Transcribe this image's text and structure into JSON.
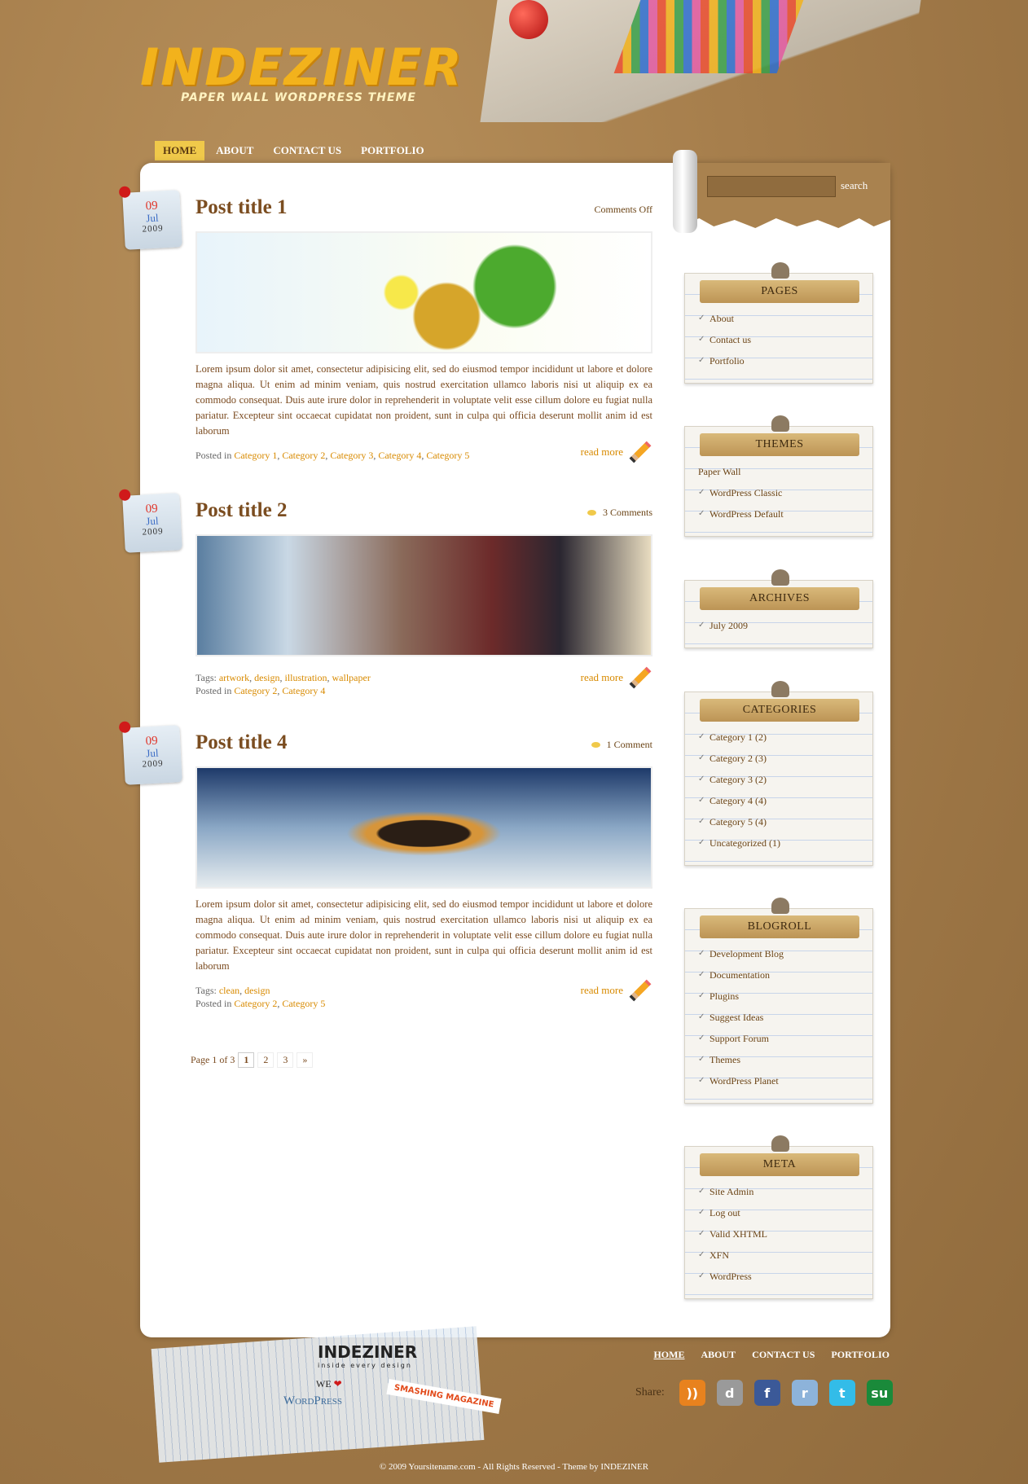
{
  "header": {
    "logo_title": "INDEZINER",
    "logo_tagline": "PAPER WALL WORDPRESS THEME"
  },
  "nav": [
    {
      "label": "HOME",
      "active": true
    },
    {
      "label": "ABOUT"
    },
    {
      "label": "CONTACT US"
    },
    {
      "label": "PORTFOLIO"
    }
  ],
  "search": {
    "value": "",
    "button": "search"
  },
  "posts": [
    {
      "day": "09",
      "month": "Jul",
      "year": "2009",
      "title": "Post title 1",
      "comments": "Comments Off",
      "comment_bubble": false,
      "image": "img1",
      "text": "Lorem ipsum dolor sit amet, consectetur adipisicing elit, sed do eiusmod tempor incididunt ut labore et dolore magna aliqua. Ut enim ad minim veniam, quis nostrud exercitation ullamco laboris nisi ut aliquip ex ea commodo consequat. Duis aute irure dolor in reprehenderit in voluptate velit esse cillum dolore eu fugiat nulla pariatur. Excepteur sint occaecat cupidatat non proident, sunt in culpa qui officia deserunt mollit anim id est laborum",
      "tags": [],
      "categories": [
        "Category 1",
        "Category 2",
        "Category 3",
        "Category 4",
        "Category 5"
      ],
      "read_more": "read more"
    },
    {
      "day": "09",
      "month": "Jul",
      "year": "2009",
      "title": "Post title 2",
      "comments": "3 Comments",
      "comment_bubble": true,
      "image": "img2",
      "text": "",
      "tags": [
        "artwork",
        "design",
        "illustration",
        "wallpaper"
      ],
      "categories": [
        "Category 2",
        "Category 4"
      ],
      "read_more": "read more"
    },
    {
      "day": "09",
      "month": "Jul",
      "year": "2009",
      "title": "Post title 4",
      "comments": "1 Comment",
      "comment_bubble": true,
      "image": "img3",
      "text": "Lorem ipsum dolor sit amet, consectetur adipisicing elit, sed do eiusmod tempor incididunt ut labore et dolore magna aliqua. Ut enim ad minim veniam, quis nostrud exercitation ullamco laboris nisi ut aliquip ex ea commodo consequat. Duis aute irure dolor in reprehenderit in voluptate velit esse cillum dolore eu fugiat nulla pariatur. Excepteur sint occaecat cupidatat non proident, sunt in culpa qui officia deserunt mollit anim id est laborum",
      "tags": [
        "clean",
        "design"
      ],
      "categories": [
        "Category 2",
        "Category 5"
      ],
      "read_more": "read more"
    }
  ],
  "labels": {
    "posted_in": "Posted in",
    "tags": "Tags:"
  },
  "pagination": {
    "summary": "Page 1 of 3",
    "pages": [
      "1",
      "2",
      "3"
    ],
    "current": "1",
    "next": "»"
  },
  "widgets": [
    {
      "title": "PAGES",
      "items": [
        {
          "label": "About"
        },
        {
          "label": "Contact us"
        },
        {
          "label": "Portfolio"
        }
      ]
    },
    {
      "title": "THEMES",
      "items": [
        {
          "label": "Paper Wall",
          "check": false
        },
        {
          "label": "WordPress Classic"
        },
        {
          "label": "WordPress Default"
        }
      ]
    },
    {
      "title": "ARCHIVES",
      "items": [
        {
          "label": "July 2009"
        }
      ]
    },
    {
      "title": "CATEGORIES",
      "items": [
        {
          "label": "Category 1 (2)"
        },
        {
          "label": "Category 2 (3)"
        },
        {
          "label": "Category 3 (2)"
        },
        {
          "label": "Category 4 (4)"
        },
        {
          "label": "Category 5 (4)"
        },
        {
          "label": "Uncategorized (1)"
        }
      ]
    },
    {
      "title": "BLOGROLL",
      "items": [
        {
          "label": "Development Blog"
        },
        {
          "label": "Documentation"
        },
        {
          "label": "Plugins"
        },
        {
          "label": "Suggest Ideas"
        },
        {
          "label": "Support Forum"
        },
        {
          "label": "Themes"
        },
        {
          "label": "WordPress Planet"
        }
      ]
    },
    {
      "title": "META",
      "items": [
        {
          "label": "Site Admin"
        },
        {
          "label": "Log out"
        },
        {
          "label": "Valid XHTML"
        },
        {
          "label": "XFN"
        },
        {
          "label": "WordPress"
        }
      ]
    }
  ],
  "footer": {
    "nav": [
      {
        "label": "HOME",
        "active": true
      },
      {
        "label": "ABOUT"
      },
      {
        "label": "CONTACT US"
      },
      {
        "label": "PORTFOLIO"
      }
    ],
    "share_label": "Share:",
    "share": [
      {
        "icon": "rss-icon",
        "glyph": "))",
        "color": "#e8821e"
      },
      {
        "icon": "delicious-icon",
        "glyph": "d",
        "color": "#9a9a9a"
      },
      {
        "icon": "facebook-icon",
        "glyph": "f",
        "color": "#3b5998"
      },
      {
        "icon": "reddit-icon",
        "glyph": "r",
        "color": "#8db3da"
      },
      {
        "icon": "twitter-icon",
        "glyph": "t",
        "color": "#33bce8"
      },
      {
        "icon": "stumbleupon-icon",
        "glyph": "su",
        "color": "#1a8a3a"
      }
    ],
    "brand_logo": "INDEZINER",
    "brand_sub": "inside every design",
    "we_love": "WE",
    "wordpress": "WordPress",
    "smashing": "SMASHING MAGAZINE",
    "copyright": "© 2009 Yoursitename.com - All Rights Reserved - Theme by INDEZINER"
  },
  "colors": {
    "link": "#d88a00",
    "text": "#7a4a1f",
    "nav_active": "#f0c94a"
  }
}
